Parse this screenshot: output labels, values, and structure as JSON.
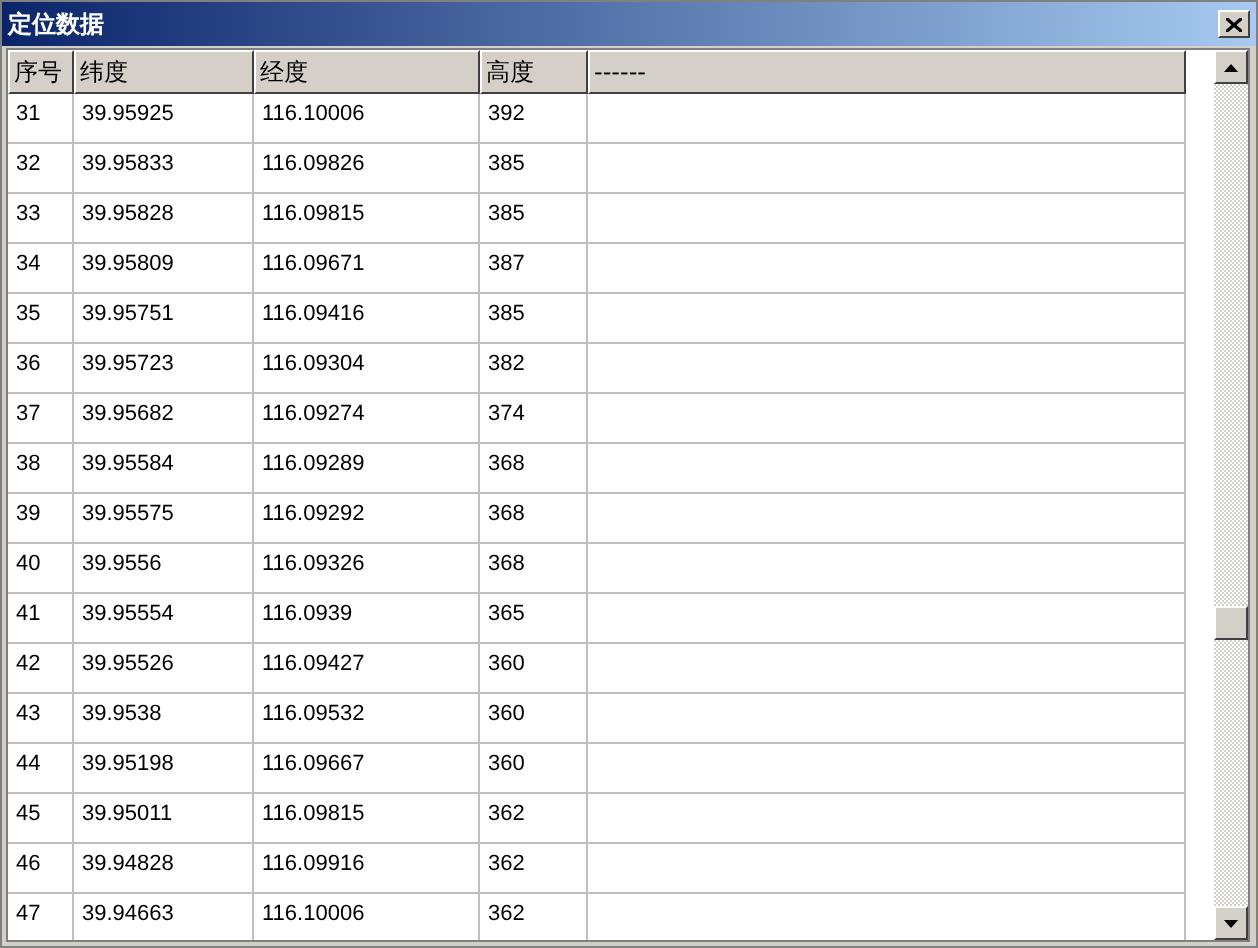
{
  "window": {
    "title": "定位数据"
  },
  "table": {
    "columns": [
      "序号",
      "纬度",
      "经度",
      "高度",
      "------"
    ],
    "rows": [
      [
        "31",
        "39.95925",
        "116.10006",
        "392"
      ],
      [
        "32",
        "39.95833",
        "116.09826",
        "385"
      ],
      [
        "33",
        "39.95828",
        "116.09815",
        "385"
      ],
      [
        "34",
        "39.95809",
        "116.09671",
        "387"
      ],
      [
        "35",
        "39.95751",
        "116.09416",
        "385"
      ],
      [
        "36",
        "39.95723",
        "116.09304",
        "382"
      ],
      [
        "37",
        "39.95682",
        "116.09274",
        "374"
      ],
      [
        "38",
        "39.95584",
        "116.09289",
        "368"
      ],
      [
        "39",
        "39.95575",
        "116.09292",
        "368"
      ],
      [
        "40",
        "39.9556",
        "116.09326",
        "368"
      ],
      [
        "41",
        "39.95554",
        "116.0939",
        "365"
      ],
      [
        "42",
        "39.95526",
        "116.09427",
        "360"
      ],
      [
        "43",
        "39.9538",
        "116.09532",
        "360"
      ],
      [
        "44",
        "39.95198",
        "116.09667",
        "360"
      ],
      [
        "45",
        "39.95011",
        "116.09815",
        "362"
      ],
      [
        "46",
        "39.94828",
        "116.09916",
        "362"
      ],
      [
        "47",
        "39.94663",
        "116.10006",
        "362"
      ]
    ]
  }
}
